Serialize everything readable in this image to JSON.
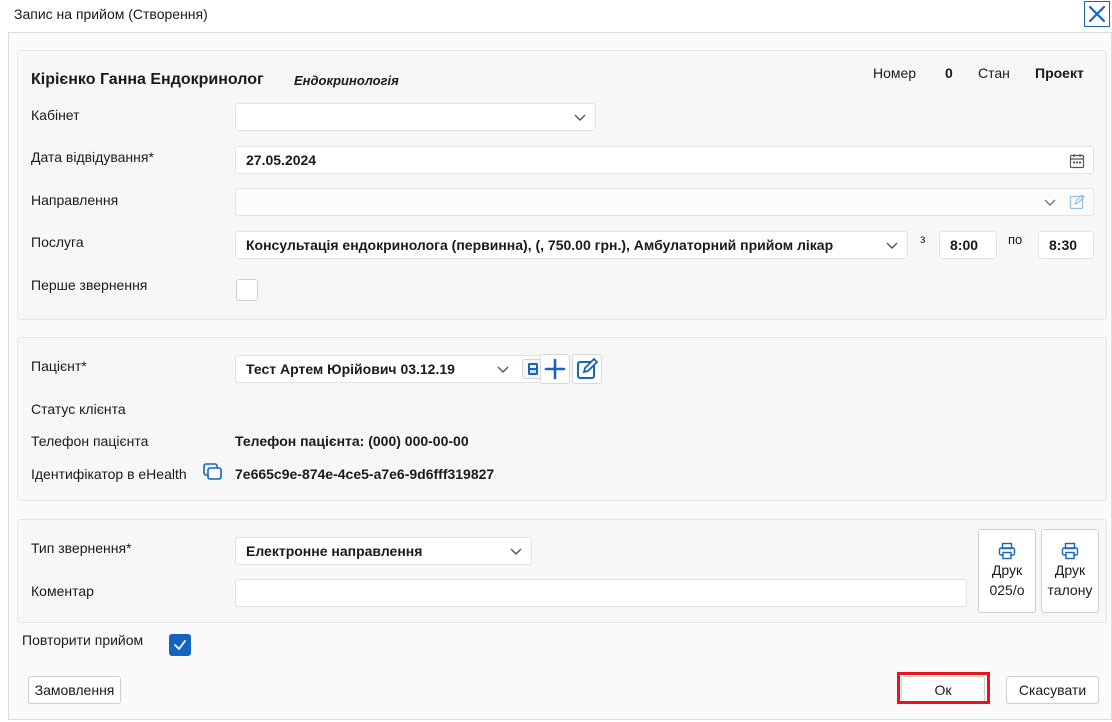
{
  "window": {
    "title": "Запис на прийом (Створення)"
  },
  "header": {
    "doctor": "Кірієнко Ганна Ендокринолог",
    "specialty": "Ендокринологія",
    "number_label": "Номер",
    "number_value": "0",
    "state_label": "Стан",
    "state_value": "Проект"
  },
  "appointment": {
    "cabinet_label": "Кабінет",
    "cabinet_value": "",
    "date_label": "Дата відвідування*",
    "date_value": "27.05.2024",
    "referral_label": "Направлення",
    "referral_value": "",
    "service_label": "Послуга",
    "service_value": "Консультація ендокринолога (первинна), (, 750.00 грн.), Амбулаторний прийом лікар",
    "from_label": "з",
    "from_value": "8:00",
    "to_label": "по",
    "to_value": "8:30",
    "first_visit_label": "Перше звернення",
    "first_visit_checked": false
  },
  "patient": {
    "patient_label": "Пацієнт*",
    "patient_value": "Тест Артем Юрійович 03.12.19",
    "status_label": "Статус клієнта",
    "phone_label": "Телефон пацієнта",
    "phone_value": "Телефон пацієнта: (000) 000-00-00",
    "ehealth_label": "Ідентифікатор в eHealth",
    "ehealth_value": "7e665c9e-874e-4ce5-a7e6-9d6fff319827"
  },
  "request": {
    "type_label": "Тип звернення*",
    "type_value": "Електронне направлення",
    "comment_label": "Коментар",
    "comment_value": "",
    "print_025_line1": "Друк",
    "print_025_line2": "025/о",
    "print_ticket_line1": "Друк",
    "print_ticket_line2": "талону"
  },
  "footer": {
    "repeat_label": "Повторити прийом",
    "repeat_checked": true,
    "order_button": "Замовлення",
    "ok_button": "Ок",
    "cancel_button": "Скасувати"
  },
  "colors": {
    "accent": "#1565c0",
    "highlight": "#e5151b"
  }
}
